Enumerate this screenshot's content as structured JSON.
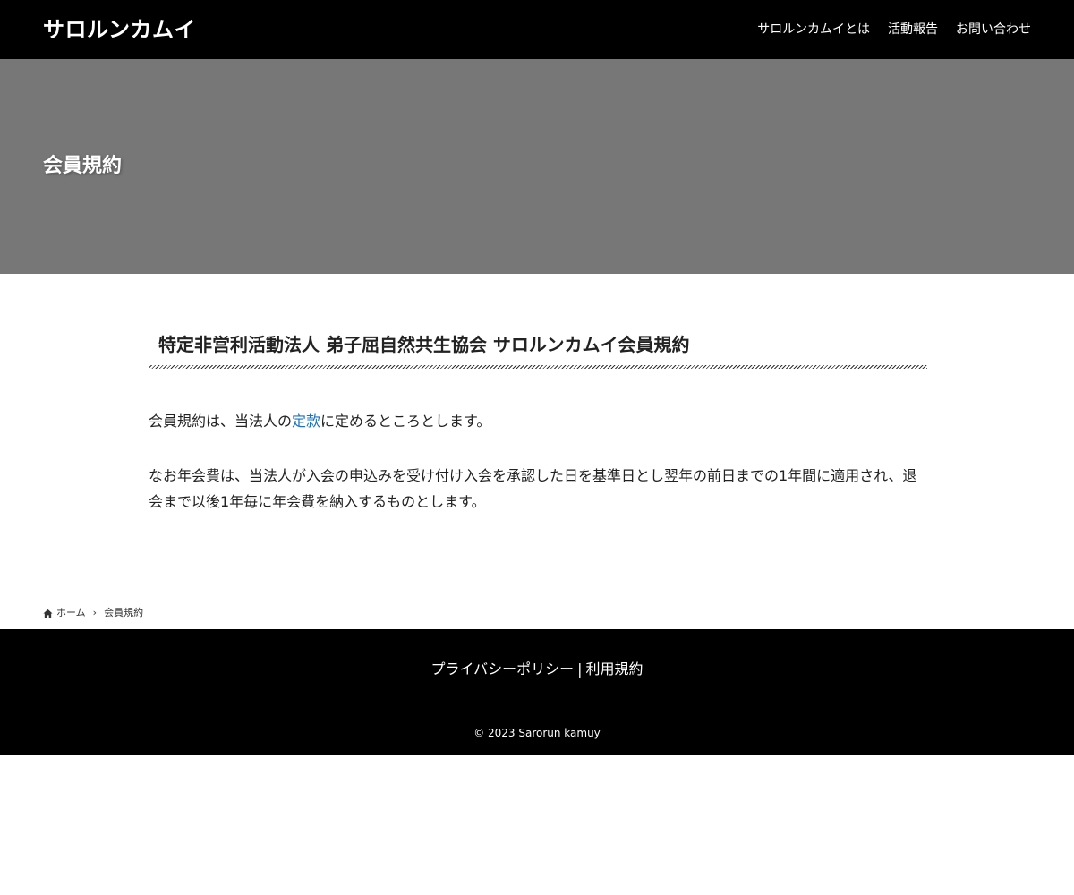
{
  "header": {
    "site_title": "サロルンカムイ",
    "nav": [
      {
        "label": "サロルンカムイとは"
      },
      {
        "label": "活動報告"
      },
      {
        "label": "お問い合わせ"
      }
    ]
  },
  "hero": {
    "title": "会員規約"
  },
  "article": {
    "heading": "特定非営利活動法人 弟子屈自然共生協会 サロルンカムイ会員規約",
    "para1_before": "会員規約は、当法人の",
    "para1_link": "定款",
    "para1_after": "に定めるところとします。",
    "para2": "なお年会費は、当法人が入会の申込みを受け付け入会を承認した日を基準日とし翌年の前日までの1年間に適用され、退会まで以後1年毎に年会費を納入するものとします。"
  },
  "breadcrumb": {
    "home_label": "ホーム",
    "separator": "›",
    "current": "会員規約"
  },
  "footer": {
    "privacy_label": "プライバシーポリシー",
    "separator": "|",
    "terms_label": "利用規約",
    "copyright": "© 2023 Sarorun kamuy"
  },
  "colors": {
    "header_bg": "#000000",
    "hero_bg": "#777777",
    "link": "#1e73be",
    "footer_bg": "#000000"
  }
}
